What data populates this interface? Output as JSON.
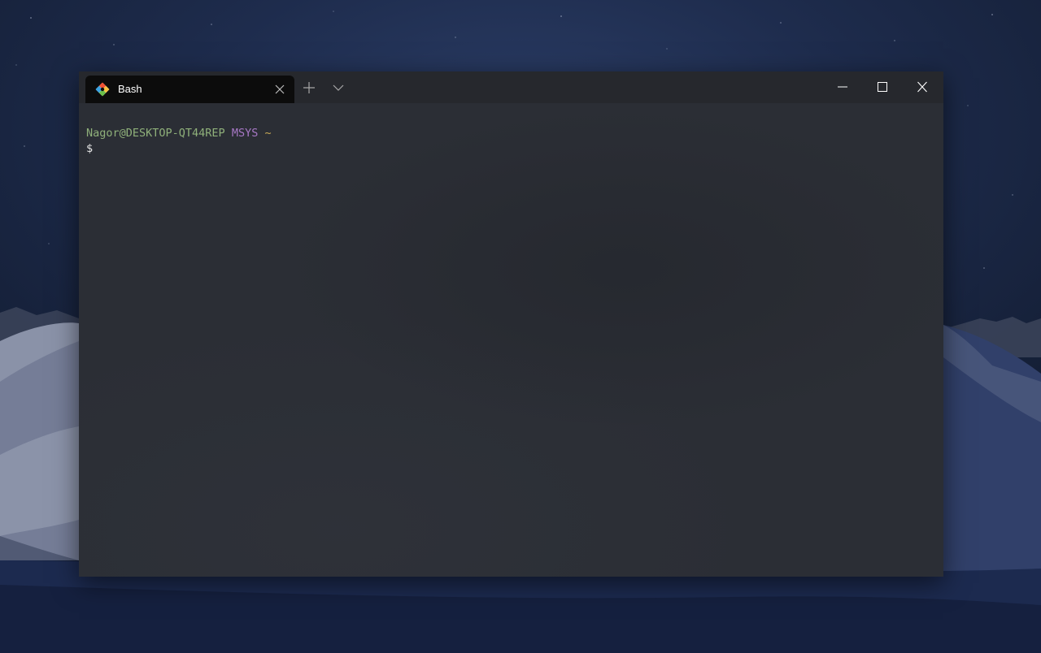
{
  "window": {
    "tab": {
      "title": "Bash",
      "icon": "git-bash-icon"
    },
    "controls": {
      "new_tab_icon": "plus-icon",
      "dropdown_icon": "chevron-down-icon",
      "minimize_icon": "minimize-icon",
      "maximize_icon": "maximize-icon",
      "close_icon": "close-icon"
    }
  },
  "terminal": {
    "user_host": "Nagor@DESKTOP-QT44REP",
    "env": "MSYS",
    "cwd": "~",
    "prompt": "$"
  },
  "colors": {
    "user_host": "#8fb07a",
    "env": "#a878c6",
    "cwd": "#c8aa56",
    "terminal_bg": "#2b2e35",
    "titlebar_bg": "#26282d",
    "tab_bg": "#0c0c0c"
  }
}
